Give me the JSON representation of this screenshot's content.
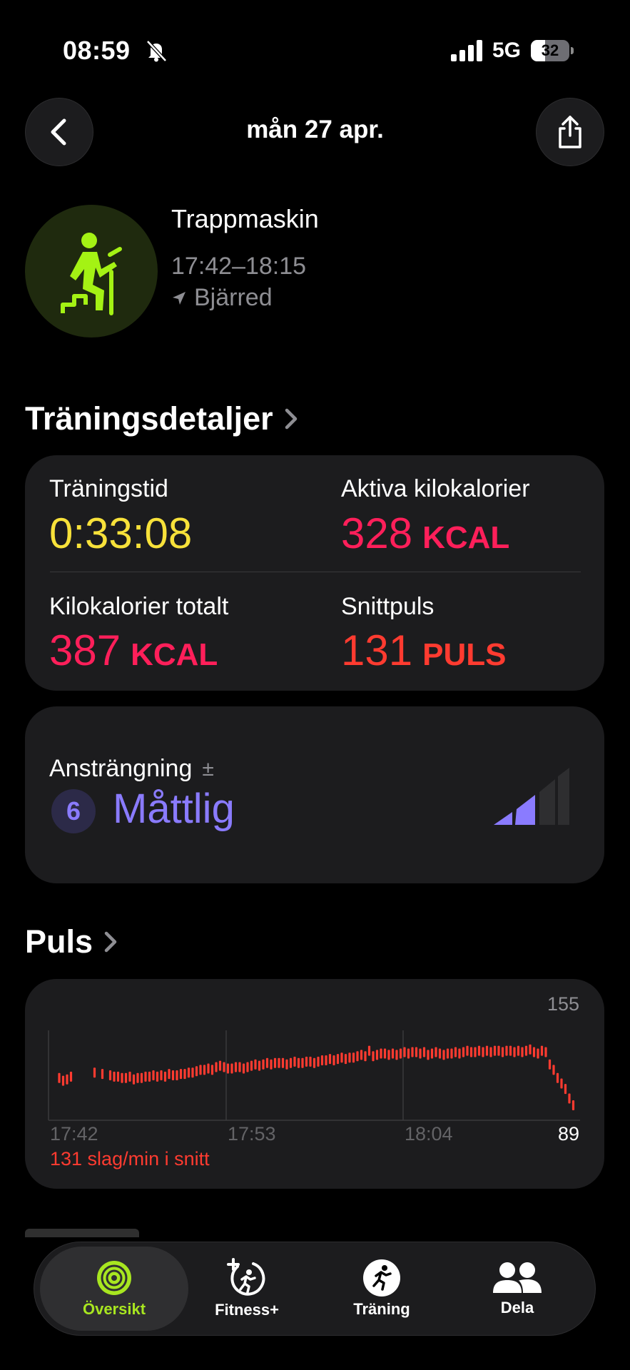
{
  "status_bar": {
    "time": "08:59",
    "network": "5G",
    "battery": "32"
  },
  "nav": {
    "title": "mån 27 apr."
  },
  "workout": {
    "name": "Trappmaskin",
    "time_range": "17:42–18:15",
    "location": "Bjärred"
  },
  "details": {
    "header": "Träningsdetaljer",
    "metrics": [
      {
        "label": "Träningstid",
        "value": "0:33:08",
        "unit": "",
        "color": "#f7e13a"
      },
      {
        "label": "Aktiva kilokalorier",
        "value": "328",
        "unit": "KCAL",
        "color": "#ff1f5a"
      },
      {
        "label": "Kilokalorier totalt",
        "value": "387",
        "unit": "KCAL",
        "color": "#ff1f5a"
      },
      {
        "label": "Snittpuls",
        "value": "131",
        "unit": "PULS",
        "color": "#ff3b30"
      }
    ]
  },
  "effort": {
    "label": "Ansträngning",
    "level": "6",
    "word": "Måttlig",
    "color": "#8a7bff"
  },
  "pulse": {
    "header": "Puls",
    "summary": "131 slag/min i snitt",
    "y_max_label": "155",
    "y_min_label": "89",
    "x_labels": [
      "17:42",
      "17:53",
      "18:04"
    ]
  },
  "chart_data": {
    "type": "scatter",
    "title": "",
    "xlabel": "",
    "ylabel": "",
    "ylim": [
      89,
      155
    ],
    "x": [
      2,
      3,
      4,
      5,
      11,
      13,
      15,
      16,
      17,
      18,
      19,
      20,
      21,
      22,
      23,
      24,
      25,
      26,
      27,
      28,
      29,
      30,
      31,
      32,
      33,
      34,
      35,
      36,
      37,
      38,
      39,
      40,
      41,
      42,
      43,
      44,
      45,
      46,
      47,
      48,
      49,
      50,
      51,
      52,
      53,
      54,
      55,
      56,
      57,
      58,
      59,
      60,
      61,
      62,
      63,
      64,
      65,
      66,
      67,
      68,
      69,
      70,
      71,
      72,
      73,
      74,
      75,
      76,
      77,
      78,
      79,
      80,
      81,
      82,
      83,
      84,
      85,
      86,
      87,
      88,
      89,
      90,
      91,
      92,
      93,
      94,
      95,
      96,
      97,
      98,
      99,
      100,
      101,
      102,
      103,
      104,
      105,
      106,
      107,
      108,
      109,
      110,
      111,
      112,
      113,
      114,
      115,
      116,
      117,
      118,
      119,
      120,
      121,
      122,
      123,
      124,
      125,
      126,
      127,
      128,
      129,
      130,
      131,
      132,
      133
    ],
    "y": [
      120,
      118,
      119,
      121,
      124,
      123,
      122,
      121,
      121,
      120,
      120,
      121,
      119,
      120,
      120,
      121,
      121,
      122,
      121,
      122,
      121,
      123,
      122,
      122,
      123,
      123,
      124,
      124,
      125,
      126,
      126,
      127,
      126,
      128,
      129,
      128,
      127,
      127,
      128,
      128,
      127,
      128,
      129,
      130,
      129,
      130,
      131,
      130,
      131,
      131,
      131,
      130,
      131,
      132,
      131,
      131,
      132,
      132,
      131,
      132,
      133,
      133,
      134,
      133,
      134,
      135,
      134,
      135,
      135,
      136,
      137,
      136,
      140,
      136,
      137,
      138,
      138,
      137,
      138,
      137,
      138,
      139,
      138,
      139,
      139,
      138,
      139,
      137,
      138,
      139,
      138,
      137,
      138,
      138,
      139,
      138,
      139,
      140,
      139,
      139,
      140,
      139,
      140,
      139,
      140,
      140,
      139,
      140,
      140,
      139,
      140,
      139,
      140,
      141,
      139,
      138,
      140,
      139,
      130,
      126,
      120,
      116,
      112,
      105,
      100
    ],
    "color": "#ff3b30"
  }
}
